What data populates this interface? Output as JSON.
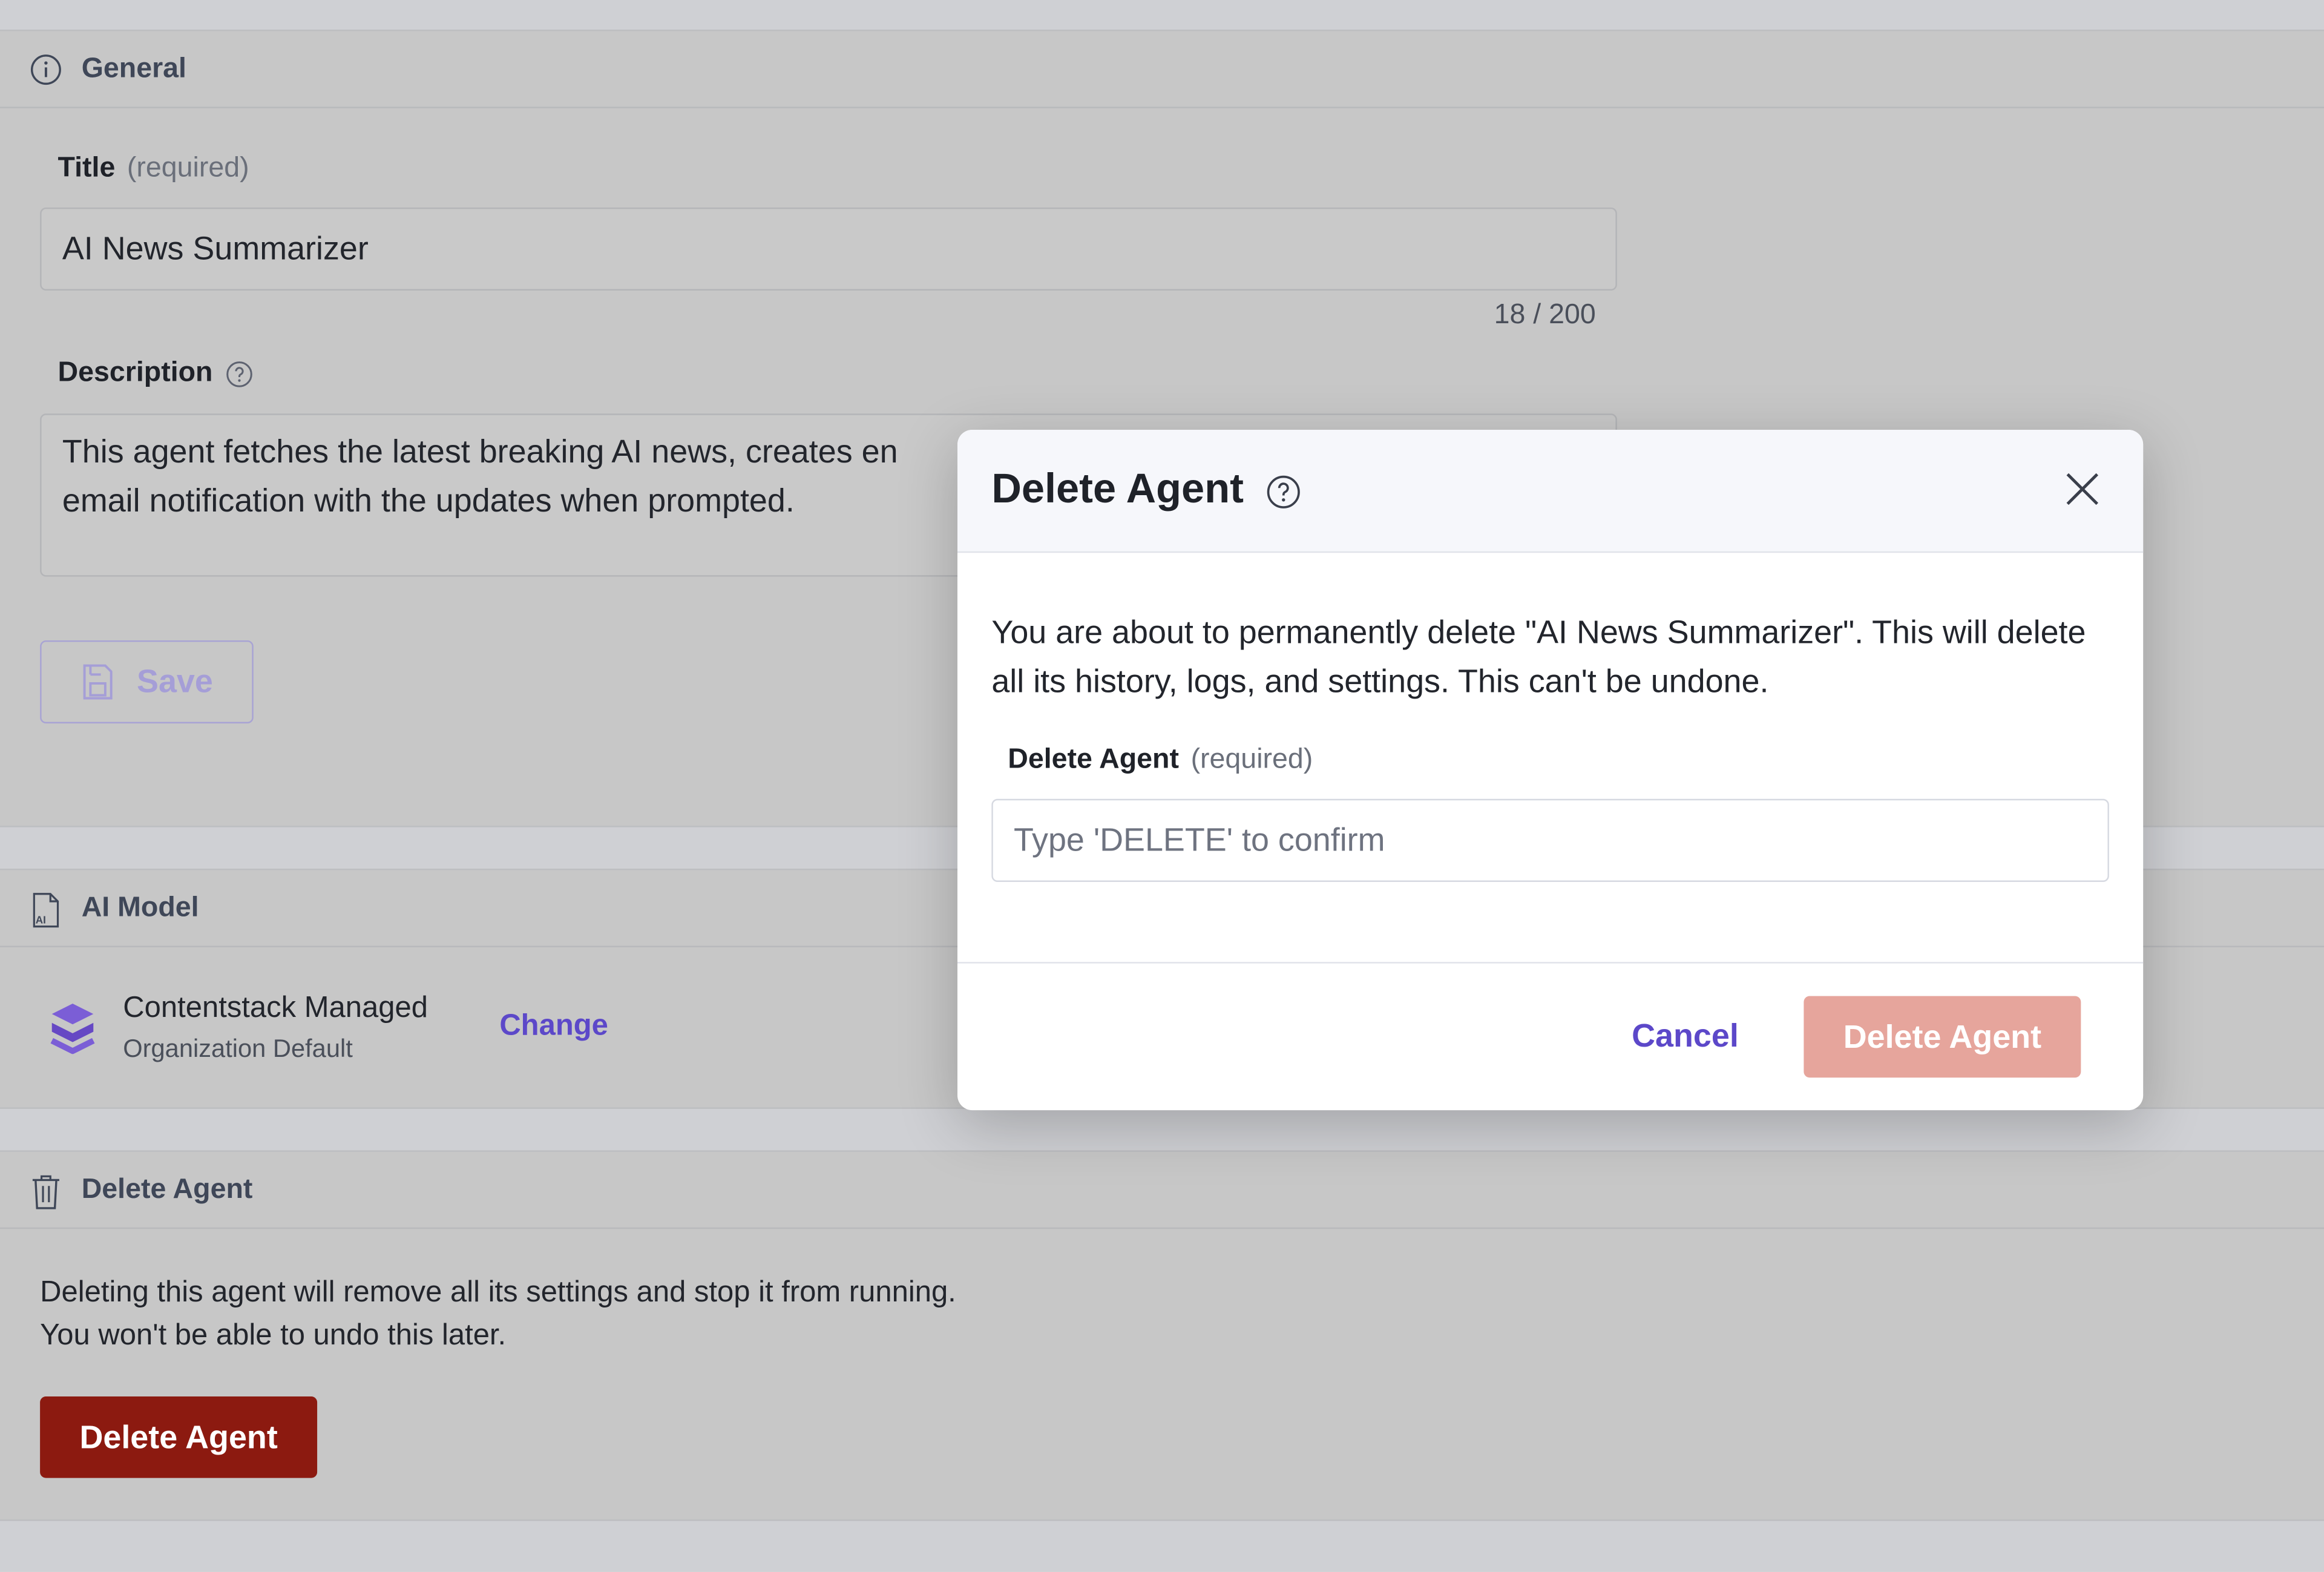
{
  "general": {
    "heading": "General",
    "title_label": "Title",
    "title_required": "(required)",
    "title_value": "AI News Summarizer",
    "title_counter": "18 / 200",
    "description_label": "Description",
    "description_line1": "This agent fetches the latest breaking AI news, creates en",
    "description_line2": "email notification with the updates when prompted.",
    "save_label": "Save"
  },
  "ai_model": {
    "heading": "AI Model",
    "model_name": "Contentstack Managed",
    "model_sub": "Organization Default",
    "change_label": "Change"
  },
  "delete_section": {
    "heading": "Delete Agent",
    "text_line1": "Deleting this agent will remove all its settings and stop it from running.",
    "text_line2": "You won't be able to undo this later.",
    "button_label": "Delete Agent"
  },
  "modal": {
    "title": "Delete Agent",
    "message": "You are about to permanently delete \"AI News Summarizer\". This will delete all its history, logs, and settings. This can't be undone.",
    "field_label": "Delete Agent",
    "field_required": "(required)",
    "input_placeholder": "Type 'DELETE' to confirm",
    "cancel_label": "Cancel",
    "confirm_label": "Delete Agent"
  },
  "colors": {
    "accent": "#5c48c9",
    "danger": "#8c1a10",
    "danger_disabled": "#e6a59c",
    "overlay": "#cfd0d4"
  },
  "icons": [
    "info-icon",
    "help-icon",
    "save-icon",
    "ai-file-icon",
    "contentstack-logo",
    "trash-icon",
    "close-icon"
  ]
}
